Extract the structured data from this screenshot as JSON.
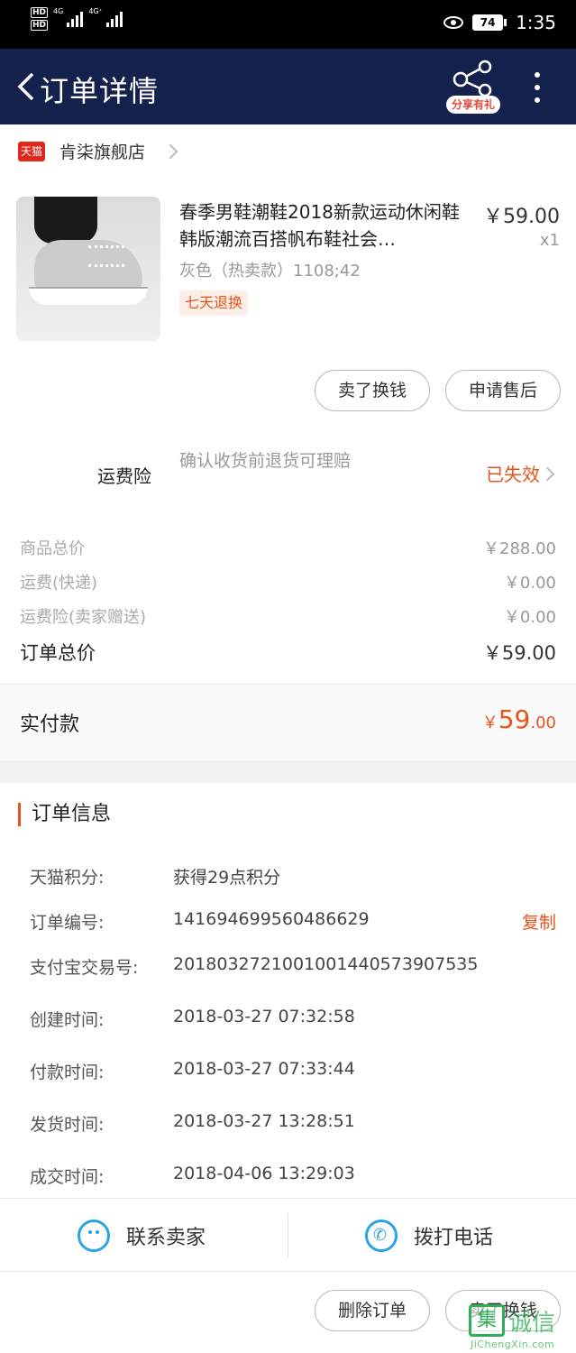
{
  "status_bar": {
    "time": "1:35",
    "battery": "74",
    "sim1": "HD",
    "sim2": "HD",
    "net1": "4G",
    "net2": "4G⁺"
  },
  "nav": {
    "title": "订单详情",
    "share_badge": "分享有礼"
  },
  "shop": {
    "platform_badge": "天猫",
    "name": "肯柒旗舰店"
  },
  "product": {
    "title": "春季男鞋潮鞋2018新款运动休闲鞋韩版潮流百搭帆布鞋社会…",
    "price": "￥59.00",
    "quantity": "x1",
    "spec": "灰色（热卖款）1108;42",
    "return_tag": "七天退换"
  },
  "actions": {
    "sell_for_cash": "卖了换钱",
    "apply_after_sale": "申请售后"
  },
  "insurance": {
    "label": "运费险",
    "description": "确认收货前退货可理赔",
    "status": "已失效"
  },
  "fees": [
    {
      "label": "商品总价",
      "value": "￥288.00"
    },
    {
      "label": "运费(快递)",
      "value": "￥0.00"
    },
    {
      "label": "运费险(卖家赠送)",
      "value": "￥0.00"
    }
  ],
  "order_total": {
    "label": "订单总价",
    "value": "￥59.00"
  },
  "paid": {
    "label": "实付款",
    "currency": "￥",
    "integer": "59",
    "decimal": ".00"
  },
  "order_info": {
    "title": "订单信息",
    "copy_label": "复制",
    "rows": [
      {
        "key": "天猫积分:",
        "value": "获得29点积分"
      },
      {
        "key": "订单编号:",
        "value": "141694699560486629"
      },
      {
        "key": "支付宝交易号:",
        "value": "2018032721001001440573907535"
      },
      {
        "key": "创建时间:",
        "value": "2018-03-27 07:32:58"
      },
      {
        "key": "付款时间:",
        "value": "2018-03-27 07:33:44"
      },
      {
        "key": "发货时间:",
        "value": "2018-03-27 13:28:51"
      },
      {
        "key": "成交时间:",
        "value": "2018-04-06 13:29:03"
      }
    ]
  },
  "contact": {
    "seller": "联系卖家",
    "phone": "拨打电话"
  },
  "footer": {
    "delete_order": "删除订单",
    "sell_for_cash": "卖了换钱"
  },
  "watermark": {
    "logo_char": "集",
    "text": "诚信",
    "url": "JiChengXin.com"
  }
}
